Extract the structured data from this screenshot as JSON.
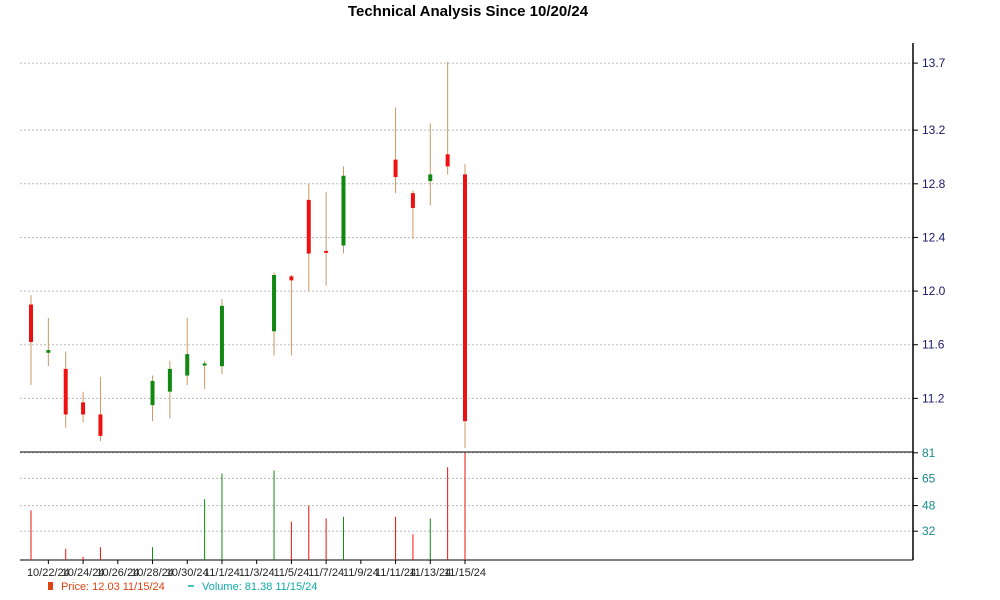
{
  "chart_data": {
    "type": "candlestick",
    "title": "Technical Analysis Since 10/20/24",
    "price_axis": {
      "ylim": [
        10.8,
        13.85
      ],
      "ticks": [
        "11.2",
        "11.6",
        "12.0",
        "12.4",
        "12.8",
        "13.2",
        "13.7"
      ]
    },
    "volume_axis": {
      "ylim": [
        14,
        81.5
      ],
      "ticks": [
        "32",
        "48",
        "65",
        "81"
      ]
    },
    "x_labels": [
      "10/22/24",
      "10/24/24",
      "10/26/24",
      "10/28/24",
      "10/30/24",
      "11/1/24",
      "11/3/24",
      "11/5/24",
      "11/7/24",
      "11/9/24",
      "11/11/24",
      "11/13/24",
      "11/15/24"
    ],
    "colors": {
      "up": "#118811",
      "down": "#ee1111",
      "wick": "#cc9966",
      "grid": "#bbbbbb",
      "price_legend": "#dd4411",
      "volume_legend": "#11aaaa"
    },
    "candles": [
      {
        "date": "10/21/24",
        "open": 11.9,
        "high": 11.97,
        "low": 11.3,
        "close": 11.62,
        "volume": 45
      },
      {
        "date": "10/22/24",
        "open": 11.54,
        "high": 11.8,
        "low": 11.44,
        "close": 11.56,
        "volume": 0
      },
      {
        "date": "10/23/24",
        "open": 11.42,
        "high": 11.55,
        "low": 10.98,
        "close": 11.08,
        "volume": 21
      },
      {
        "date": "10/24/24",
        "open": 11.17,
        "high": 11.25,
        "low": 11.02,
        "close": 11.08,
        "volume": 16
      },
      {
        "date": "10/25/24",
        "open": 11.08,
        "high": 11.36,
        "low": 10.88,
        "close": 10.92,
        "volume": 22
      },
      {
        "date": "10/28/24",
        "open": 11.15,
        "high": 11.37,
        "low": 11.03,
        "close": 11.33,
        "volume": 22
      },
      {
        "date": "10/29/24",
        "open": 11.25,
        "high": 11.48,
        "low": 11.05,
        "close": 11.42,
        "volume": 0
      },
      {
        "date": "10/30/24",
        "open": 11.37,
        "high": 11.8,
        "low": 11.3,
        "close": 11.53,
        "volume": 0
      },
      {
        "date": "10/31/24",
        "open": 11.46,
        "high": 11.48,
        "low": 11.27,
        "close": 11.46,
        "volume": 52
      },
      {
        "date": "11/1/24",
        "open": 11.44,
        "high": 11.94,
        "low": 11.38,
        "close": 11.89,
        "volume": 68
      },
      {
        "date": "11/4/24",
        "open": 11.7,
        "high": 12.14,
        "low": 11.52,
        "close": 12.12,
        "volume": 70
      },
      {
        "date": "11/5/24",
        "open": 12.11,
        "high": 12.12,
        "low": 11.52,
        "close": 12.08,
        "volume": 38
      },
      {
        "date": "11/6/24",
        "open": 12.68,
        "high": 12.8,
        "low": 12.0,
        "close": 12.28,
        "volume": 48
      },
      {
        "date": "11/7/24",
        "open": 12.3,
        "high": 12.74,
        "low": 12.04,
        "close": 12.29,
        "volume": 40
      },
      {
        "date": "11/8/24",
        "open": 12.34,
        "high": 12.93,
        "low": 12.28,
        "close": 12.86,
        "volume": 41
      },
      {
        "date": "11/11/24",
        "open": 12.98,
        "high": 13.37,
        "low": 12.73,
        "close": 12.85,
        "volume": 41
      },
      {
        "date": "11/12/24",
        "open": 12.73,
        "high": 12.75,
        "low": 12.39,
        "close": 12.62,
        "volume": 30
      },
      {
        "date": "11/13/24",
        "open": 12.82,
        "high": 13.25,
        "low": 12.64,
        "close": 12.87,
        "volume": 40
      },
      {
        "date": "11/14/24",
        "open": 13.02,
        "high": 13.71,
        "low": 12.87,
        "close": 12.93,
        "volume": 72
      },
      {
        "date": "11/15/24",
        "open": 12.87,
        "high": 12.95,
        "low": 10.83,
        "close": 11.03,
        "volume": 81
      }
    ],
    "legend": {
      "price_label": "Price: 12.03  11/15/24",
      "volume_label": "Volume: 81.38  11/15/24"
    }
  }
}
